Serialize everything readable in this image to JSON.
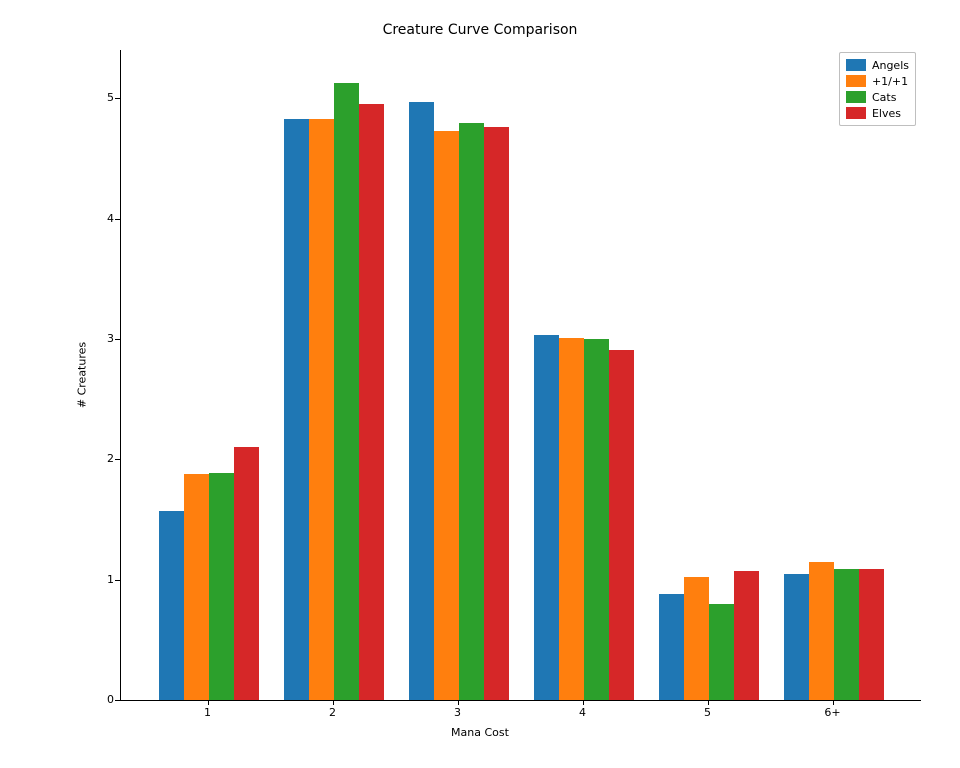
{
  "chart_data": {
    "type": "bar",
    "title": "Creature Curve Comparison",
    "xlabel": "Mana Cost",
    "ylabel": "# Creatures",
    "categories": [
      "1",
      "2",
      "3",
      "4",
      "5",
      "6+"
    ],
    "series": [
      {
        "name": "Angels",
        "color": "#1f77b4",
        "values": [
          1.57,
          4.83,
          4.97,
          3.03,
          0.88,
          1.05
        ]
      },
      {
        "name": "+1/+1",
        "color": "#ff7f0e",
        "values": [
          1.88,
          4.83,
          4.73,
          3.01,
          1.02,
          1.15
        ]
      },
      {
        "name": "Cats",
        "color": "#2ca02c",
        "values": [
          1.89,
          5.13,
          4.79,
          3.0,
          0.8,
          1.09
        ]
      },
      {
        "name": "Elves",
        "color": "#d62728",
        "values": [
          2.1,
          4.95,
          4.76,
          2.91,
          1.07,
          1.09
        ]
      }
    ],
    "ylim": [
      0,
      5.4
    ],
    "yticks": [
      0,
      1,
      2,
      3,
      4,
      5
    ],
    "legend_pos": "upper-right"
  }
}
